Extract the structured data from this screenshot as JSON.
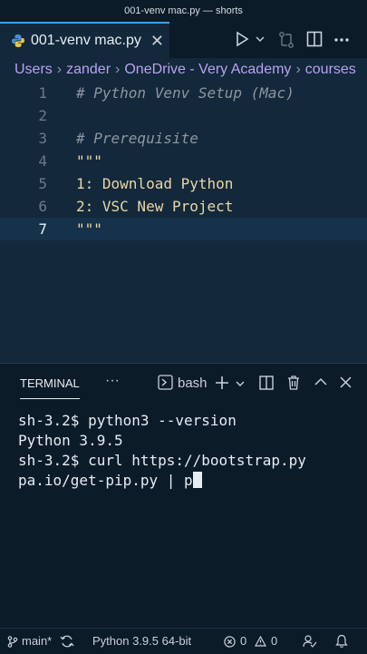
{
  "window": {
    "title": "001-venv mac.py — shorts"
  },
  "tab": {
    "label": "001-venv mac.py",
    "icon": "python-icon"
  },
  "toolbar": {
    "icons": [
      "run-icon",
      "chevron-down-icon",
      "compare-icon",
      "split-editor-icon",
      "more-icon"
    ]
  },
  "breadcrumb": [
    "Users",
    "zander",
    "OneDrive - Very Academy",
    "courses"
  ],
  "editor": {
    "lines": [
      {
        "n": "1",
        "text": "# Python Venv Setup (Mac)",
        "kind": "comment"
      },
      {
        "n": "2",
        "text": "",
        "kind": "plain"
      },
      {
        "n": "3",
        "text": "# Prerequisite",
        "kind": "comment"
      },
      {
        "n": "4",
        "text": "\"\"\"",
        "kind": "str"
      },
      {
        "n": "5",
        "text": "1: Download Python",
        "kind": "str"
      },
      {
        "n": "6",
        "text": "2: VSC New Project",
        "kind": "str"
      },
      {
        "n": "7",
        "text": "\"\"\"",
        "kind": "str"
      }
    ],
    "active_line": "7"
  },
  "panel": {
    "tab_label": "TERMINAL",
    "more": "···",
    "shell": "bash",
    "terminal_lines": [
      "sh-3.2$ python3 --version",
      "Python 3.9.5",
      "sh-3.2$ curl https://bootstrap.py",
      "pa.io/get-pip.py | p"
    ]
  },
  "status": {
    "branch": "main*",
    "interpreter": "Python 3.9.5 64-bit",
    "errors": "0",
    "warnings": "0"
  },
  "colors": {
    "accent": "#3aa0ff",
    "editor_bg": "#13283a",
    "panel_bg": "#0c1b28",
    "breadcrumb": "#b8a2f2"
  }
}
